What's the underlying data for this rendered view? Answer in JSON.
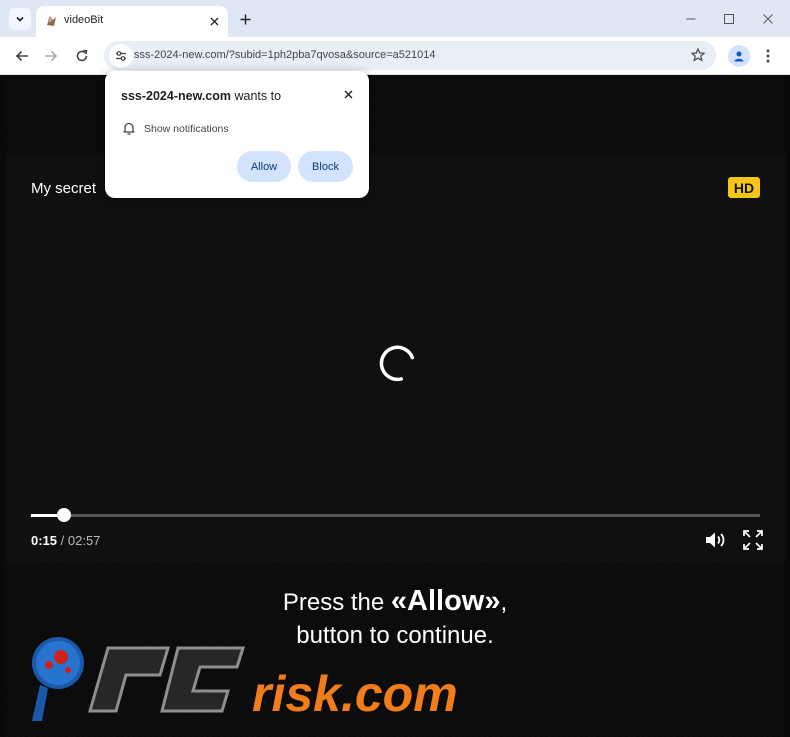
{
  "tab": {
    "title": "videoBit"
  },
  "address_bar": {
    "url": "sss-2024-new.com/?subid=1ph2pba7qvosa&source=a521014"
  },
  "permission_prompt": {
    "site": "sss-2024-new.com",
    "wants_to": " wants to",
    "permission": "Show notifications",
    "allow_label": "Allow",
    "block_label": "Block"
  },
  "player": {
    "title": "My secret",
    "hd_badge": "HD",
    "current_time": "0:15",
    "separator": " / ",
    "duration": "02:57",
    "progress_fraction": 0.045
  },
  "cta": {
    "line1_prefix": "Press the ",
    "line1_emph": "«Allow»",
    "line1_suffix": ",",
    "line2": "button to continue."
  },
  "watermark": {
    "text": "PCrisk.com"
  },
  "colors": {
    "tabstrip": "#dfe7f5",
    "accent_button": "#d3e3fd",
    "hd_badge": "#f5c518",
    "watermark_orange": "#f07d1a"
  }
}
